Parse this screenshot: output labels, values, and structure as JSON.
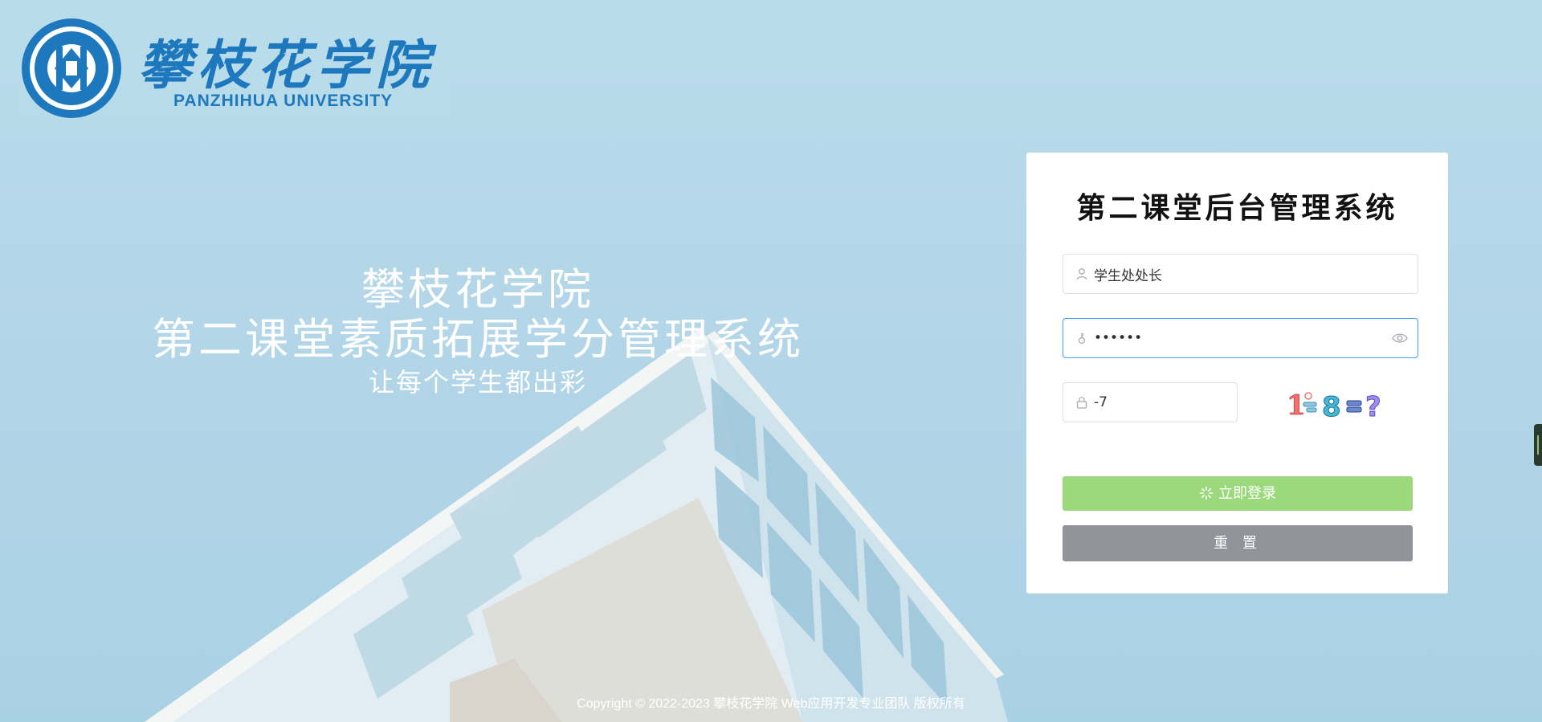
{
  "header": {
    "logo_cn": "攀枝花学院",
    "logo_en": "PANZHIHUA UNIVERSITY",
    "emblem_icon": "university-emblem-icon"
  },
  "hero": {
    "line1": "攀枝花学院",
    "line2": "第二课堂素质拓展学分管理系统",
    "line3": "让每个学生都出彩"
  },
  "login": {
    "title": "第二课堂后台管理系统",
    "username": {
      "value": "学生处处长",
      "icon": "user-icon"
    },
    "password": {
      "value": "••••••",
      "icon": "key-icon",
      "toggle_icon": "eye-icon"
    },
    "captcha": {
      "value": "-7",
      "icon": "lock-icon",
      "image_text": "1−8=?"
    },
    "login_button": "立即登录",
    "reset_button": "重 置",
    "login_button_color": "#9bd97c",
    "reset_button_color": "#909399"
  },
  "footer": {
    "copyright": "Copyright © 2022-2023 攀枝花学院 Web应用开发专业团队 版权所有"
  }
}
